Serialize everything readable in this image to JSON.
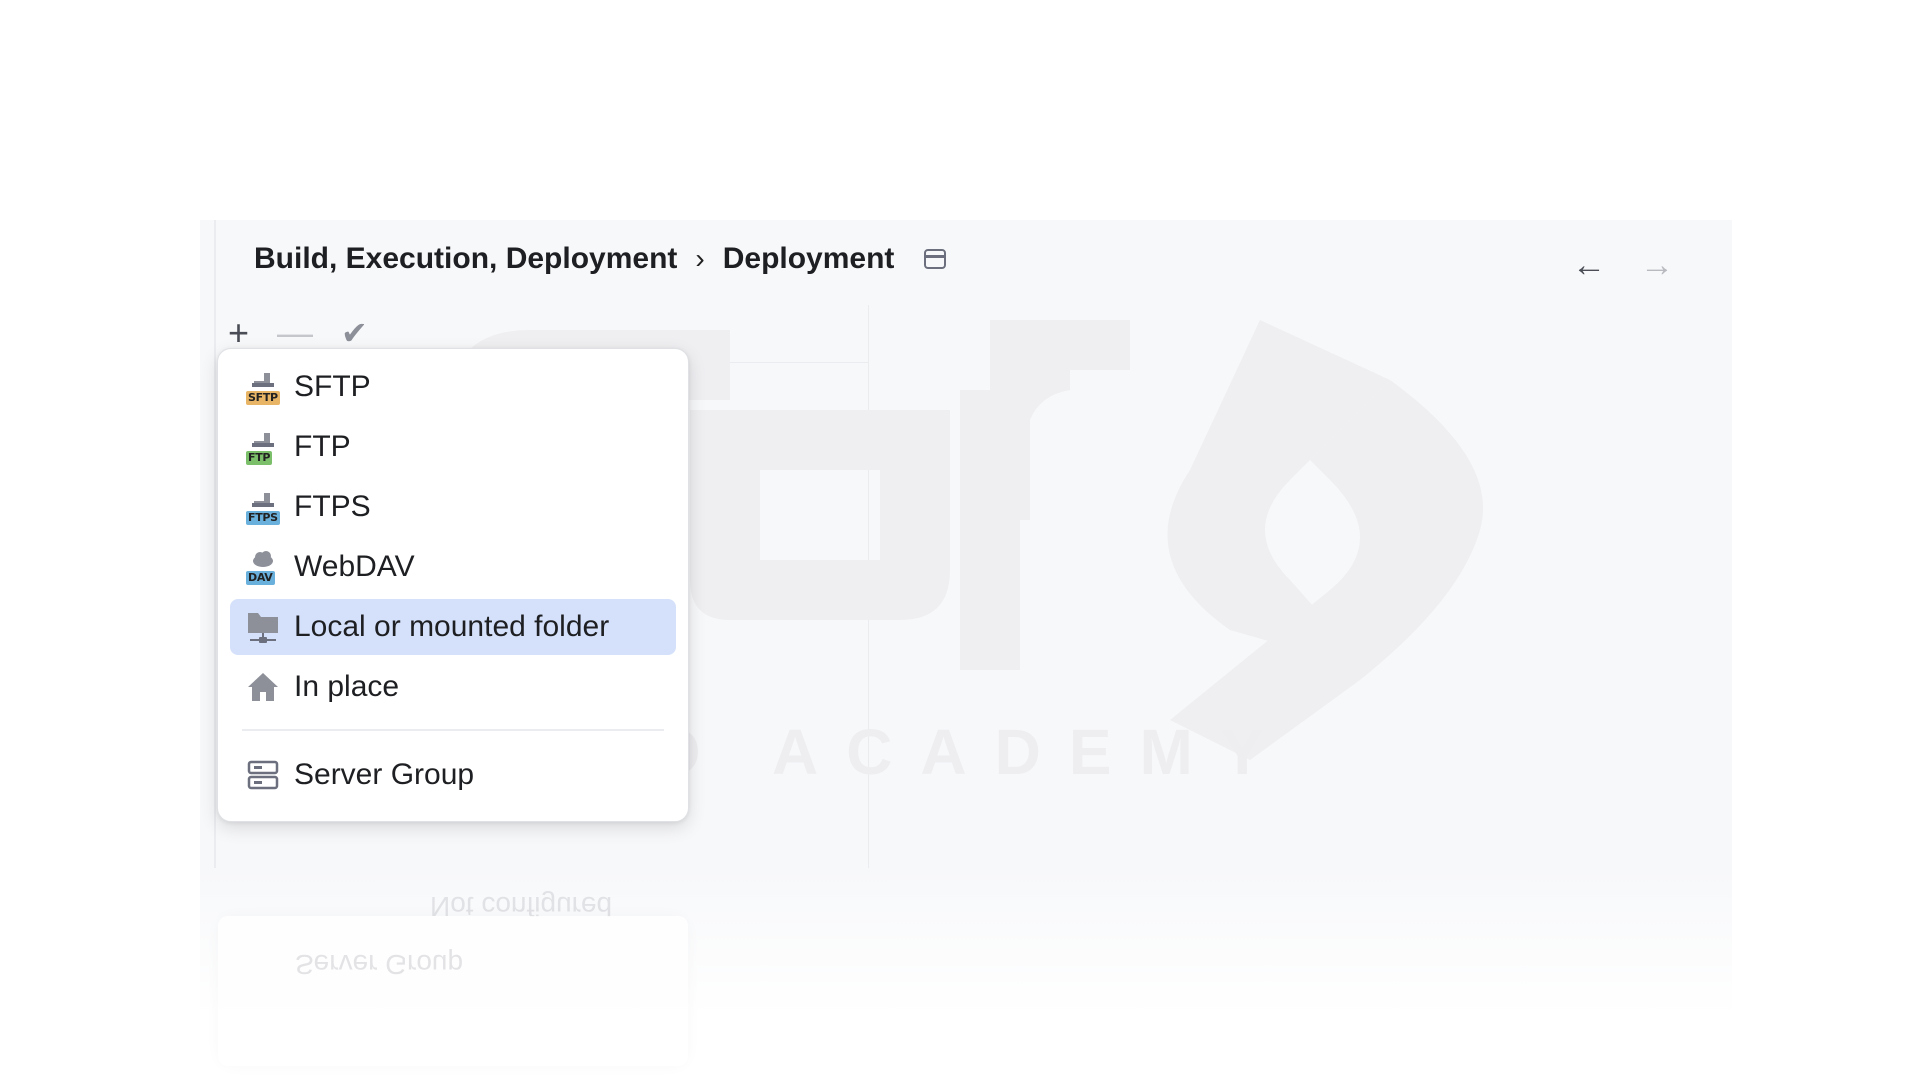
{
  "breadcrumb": {
    "parent": "Build, Execution, Deployment",
    "separator": "›",
    "current": "Deployment"
  },
  "nav": {
    "back": "←",
    "forward": "→"
  },
  "toolbar": {
    "add": "+",
    "remove": "—",
    "apply": "✔"
  },
  "menu": {
    "items": [
      {
        "label": "SFTP",
        "icon": "sftp-icon",
        "tag": "SFTP"
      },
      {
        "label": "FTP",
        "icon": "ftp-icon",
        "tag": "FTP"
      },
      {
        "label": "FTPS",
        "icon": "ftps-icon",
        "tag": "FTPS"
      },
      {
        "label": "WebDAV",
        "icon": "webdav-icon",
        "tag": "DAV"
      },
      {
        "label": "Local or mounted folder",
        "icon": "folder-icon",
        "selected": true
      },
      {
        "label": "In place",
        "icon": "home-icon"
      }
    ],
    "footer_item": {
      "label": "Server Group",
      "icon": "server-group-icon"
    }
  },
  "background": {
    "status_text": "Not configured"
  },
  "watermark": {
    "text": "ATRO ACADEMY"
  },
  "colors": {
    "panel_bg": "#f7f8fa",
    "selection": "#d5e1fa",
    "sftp_tag": "#e8b566",
    "ftp_tag": "#7cbf6b",
    "ftps_tag": "#6ab0dc"
  }
}
